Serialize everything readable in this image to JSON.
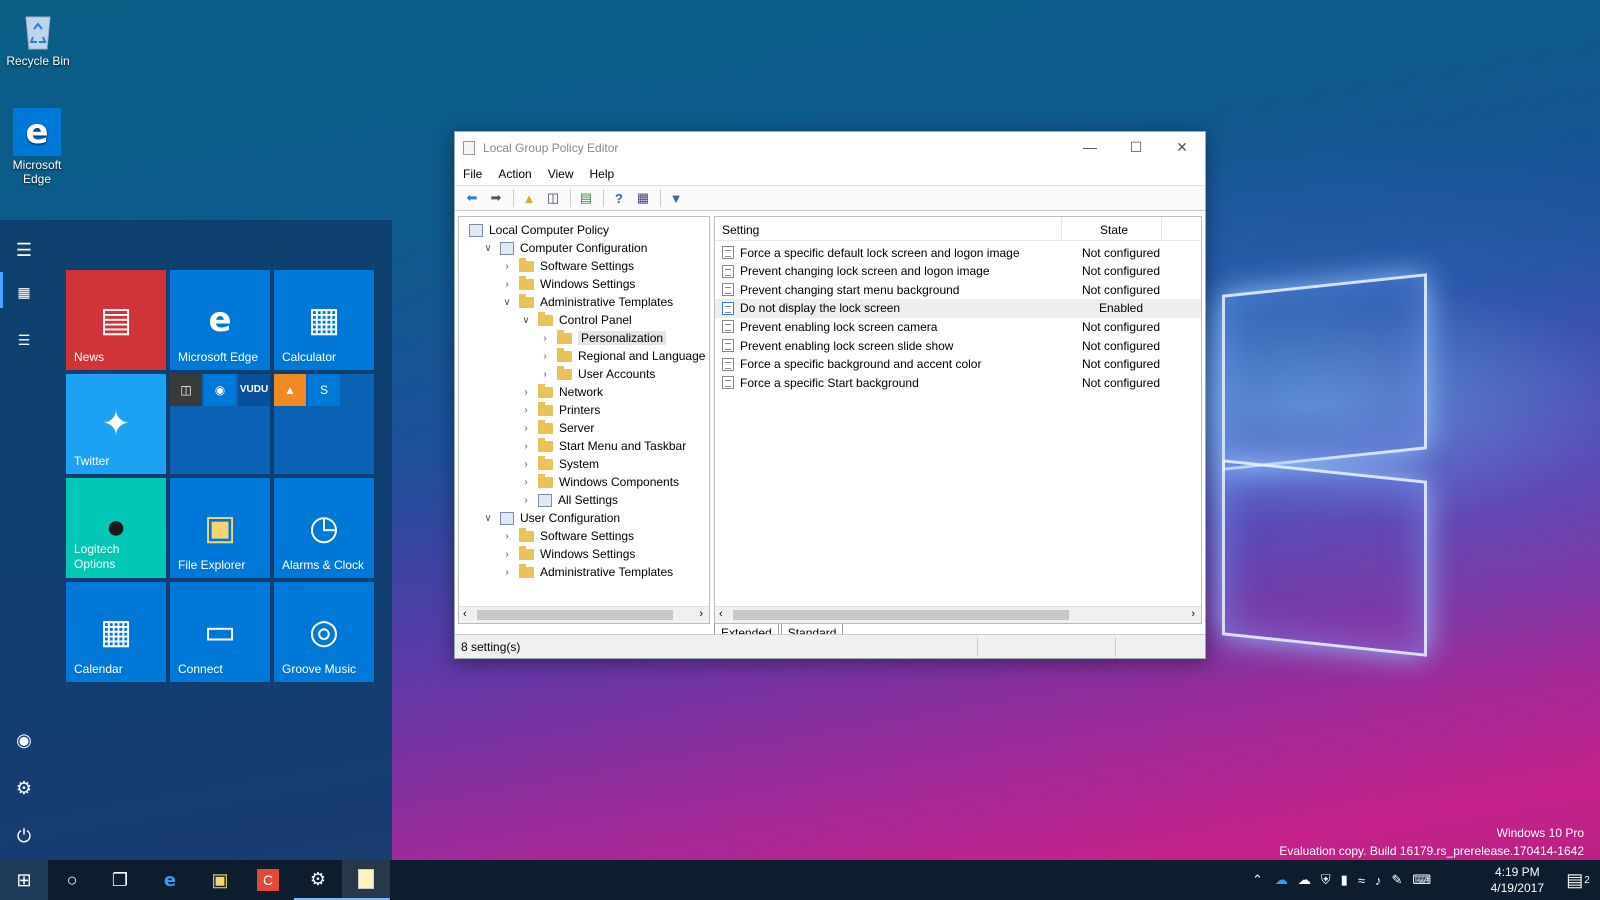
{
  "desktop": {
    "icons": [
      {
        "label": "Recycle Bin",
        "icon": "recycle-bin-icon"
      },
      {
        "label": "Microsoft Edge",
        "icon": "edge-icon"
      }
    ],
    "watermark_line1": "Windows 10 Pro",
    "watermark_line2": "Evaluation copy. Build 16179.rs_prerelease.170414-1642"
  },
  "start_menu": {
    "tiles": [
      {
        "label": "News",
        "icon": "news-icon",
        "color": "#d13438"
      },
      {
        "label": "Microsoft Edge",
        "icon": "edge-icon",
        "color": "#0078d7"
      },
      {
        "label": "Calculator",
        "icon": "calculator-icon",
        "color": "#0078d7"
      },
      {
        "label": "Twitter",
        "icon": "twitter-icon",
        "color": "#1da1f2"
      },
      {
        "label": "VUDU",
        "icon": "vudu-icon",
        "color": "#0078d7"
      },
      {
        "label": "Logitech Options",
        "icon": "logitech-mouse-icon",
        "color": "#00c8b4"
      },
      {
        "label": "File Explorer",
        "icon": "folder-icon",
        "color": "#0078d7"
      },
      {
        "label": "Alarms & Clock",
        "icon": "alarm-clock-icon",
        "color": "#0078d7"
      },
      {
        "label": "Calendar",
        "icon": "calendar-icon",
        "color": "#0078d7"
      },
      {
        "label": "Connect",
        "icon": "connect-icon",
        "color": "#0078d7"
      },
      {
        "label": "Groove Music",
        "icon": "groove-music-icon",
        "color": "#0078d7"
      }
    ]
  },
  "window": {
    "title": "Local Group Policy Editor",
    "menu": [
      "File",
      "Action",
      "View",
      "Help"
    ],
    "tree": [
      {
        "label": "Local Computer Policy",
        "level": 0,
        "exp": "",
        "kind": "policy"
      },
      {
        "label": "Computer Configuration",
        "level": 1,
        "exp": "v",
        "kind": "computer"
      },
      {
        "label": "Software Settings",
        "level": 2,
        "exp": ">",
        "kind": "folder"
      },
      {
        "label": "Windows Settings",
        "level": 2,
        "exp": ">",
        "kind": "folder"
      },
      {
        "label": "Administrative Templates",
        "level": 2,
        "exp": "v",
        "kind": "folder"
      },
      {
        "label": "Control Panel",
        "level": 3,
        "exp": "v",
        "kind": "folder"
      },
      {
        "label": "Personalization",
        "level": 4,
        "exp": ">",
        "kind": "folder",
        "selected": true
      },
      {
        "label": "Regional and Language Opt",
        "level": 4,
        "exp": ">",
        "kind": "folder"
      },
      {
        "label": "User Accounts",
        "level": 4,
        "exp": ">",
        "kind": "folder"
      },
      {
        "label": "Network",
        "level": 3,
        "exp": ">",
        "kind": "folder"
      },
      {
        "label": "Printers",
        "level": 3,
        "exp": ">",
        "kind": "folder"
      },
      {
        "label": "Server",
        "level": 3,
        "exp": ">",
        "kind": "folder"
      },
      {
        "label": "Start Menu and Taskbar",
        "level": 3,
        "exp": ">",
        "kind": "folder"
      },
      {
        "label": "System",
        "level": 3,
        "exp": ">",
        "kind": "folder"
      },
      {
        "label": "Windows Components",
        "level": 3,
        "exp": ">",
        "kind": "folder"
      },
      {
        "label": "All Settings",
        "level": 3,
        "exp": ">",
        "kind": "settings"
      },
      {
        "label": "User Configuration",
        "level": 1,
        "exp": "v",
        "kind": "user"
      },
      {
        "label": "Software Settings",
        "level": 2,
        "exp": ">",
        "kind": "folder"
      },
      {
        "label": "Windows Settings",
        "level": 2,
        "exp": ">",
        "kind": "folder"
      },
      {
        "label": "Administrative Templates",
        "level": 2,
        "exp": ">",
        "kind": "folder"
      }
    ],
    "columns": {
      "setting": "Setting",
      "state": "State"
    },
    "rows": [
      {
        "setting": "Force a specific default lock screen and logon image",
        "state": "Not configured"
      },
      {
        "setting": "Prevent changing lock screen and logon image",
        "state": "Not configured"
      },
      {
        "setting": "Prevent changing start menu background",
        "state": "Not configured"
      },
      {
        "setting": "Do not display the lock screen",
        "state": "Enabled",
        "highlight": true
      },
      {
        "setting": "Prevent enabling lock screen camera",
        "state": "Not configured"
      },
      {
        "setting": "Prevent enabling lock screen slide show",
        "state": "Not configured"
      },
      {
        "setting": "Force a specific background and accent color",
        "state": "Not configured"
      },
      {
        "setting": "Force a specific Start background",
        "state": "Not configured"
      }
    ],
    "tabs": [
      "Extended",
      "Standard"
    ],
    "status": "8 setting(s)"
  },
  "taskbar": {
    "time": "4:19 PM",
    "date": "4/19/2017",
    "notification_count": "2"
  }
}
